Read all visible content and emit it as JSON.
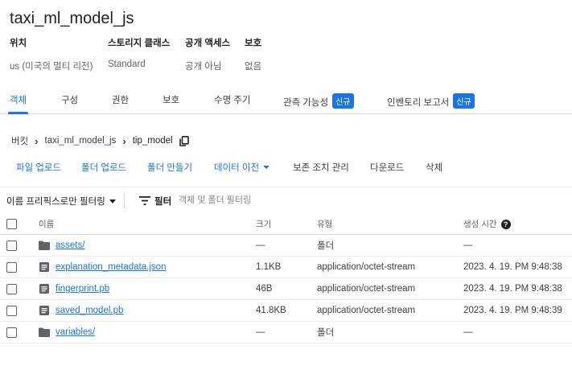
{
  "bucket": {
    "name": "taxi_ml_model_js"
  },
  "meta": [
    {
      "label": "위치",
      "value": "us (미국의 멀티 리전)"
    },
    {
      "label": "스토리지 클래스",
      "value": "Standard"
    },
    {
      "label": "공개 액세스",
      "value": "공개 아님"
    },
    {
      "label": "보호",
      "value": "없음"
    }
  ],
  "tabs": [
    {
      "label": "객체",
      "active": true
    },
    {
      "label": "구성"
    },
    {
      "label": "권한"
    },
    {
      "label": "보호"
    },
    {
      "label": "수명 주기"
    },
    {
      "label": "관측 가능성",
      "badge": "신규"
    },
    {
      "label": "인벤토리 보고서",
      "badge": "신규"
    }
  ],
  "breadcrumb": {
    "root": "버킷",
    "bucket": "taxi_ml_model_js",
    "folder": "tip_model",
    "copy_icon": "copy-icon"
  },
  "actions": {
    "upload_file": "파일 업로드",
    "upload_folder": "폴더 업로드",
    "create_folder": "폴더 만들기",
    "transfer_data": "데이터 이전",
    "manage_holds": "보존 조치 관리",
    "download": "다운로드",
    "delete": "삭제"
  },
  "filter": {
    "prefix_select": "이름 프리픽스로만 필터링",
    "label": "필터",
    "placeholder": "객체 및 폴더 필터링"
  },
  "table": {
    "columns": {
      "name": "이름",
      "size": "크기",
      "type": "유형",
      "created": "생성 시간"
    },
    "rows": [
      {
        "name": "assets/",
        "icon": "folder-icon",
        "size": "—",
        "type": "폴더",
        "created": "—"
      },
      {
        "name": "explanation_metadata.json",
        "icon": "file-icon",
        "size": "1.1KB",
        "type": "application/octet-stream",
        "created": "2023. 4. 19. PM 9:48:38"
      },
      {
        "name": "fingerprint.pb",
        "icon": "file-icon",
        "size": "46B",
        "type": "application/octet-stream",
        "created": "2023. 4. 19. PM 9:48:38"
      },
      {
        "name": "saved_model.pb",
        "icon": "file-icon",
        "size": "41.8KB",
        "type": "application/octet-stream",
        "created": "2023. 4. 19. PM 9:48:39"
      },
      {
        "name": "variables/",
        "icon": "folder-icon",
        "size": "—",
        "type": "폴더",
        "created": "—"
      }
    ]
  },
  "colors": {
    "accent": "#1a73e8",
    "text": "#202124",
    "muted": "#5f6368"
  }
}
